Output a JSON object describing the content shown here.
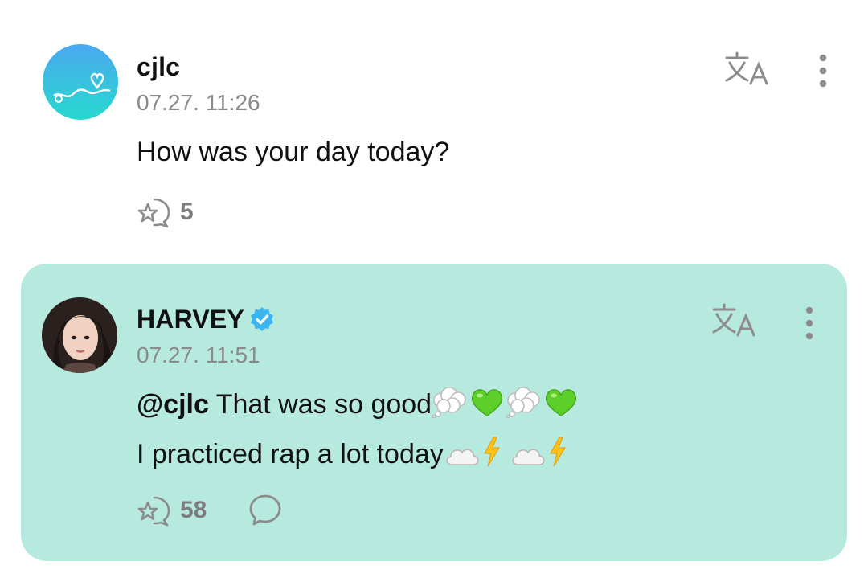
{
  "comments": [
    {
      "username": "cjlc",
      "timestamp": "07.27. 11:26",
      "text": "How was your day today?",
      "reaction_count": "5",
      "avatar_color": "#34c6e0"
    },
    {
      "username": "HARVEY",
      "verified": true,
      "timestamp": "07.27. 11:51",
      "mention": "@cjlc",
      "line1": " That was so good",
      "line2": "I practiced rap a lot today",
      "reaction_count": "58",
      "highlight_color": "#b7eadf"
    }
  ],
  "icons": {
    "translate": "translate-icon",
    "more": "more-vertical-icon",
    "reaction": "reaction-icon",
    "reply": "reply-bubble-icon",
    "verified": "verified-badge-icon",
    "line1_emojis": [
      "thought-bubble",
      "green-heart",
      "thought-bubble",
      "green-heart"
    ],
    "line2_emojis": [
      "cloud",
      "lightning",
      "cloud",
      "lightning"
    ]
  }
}
